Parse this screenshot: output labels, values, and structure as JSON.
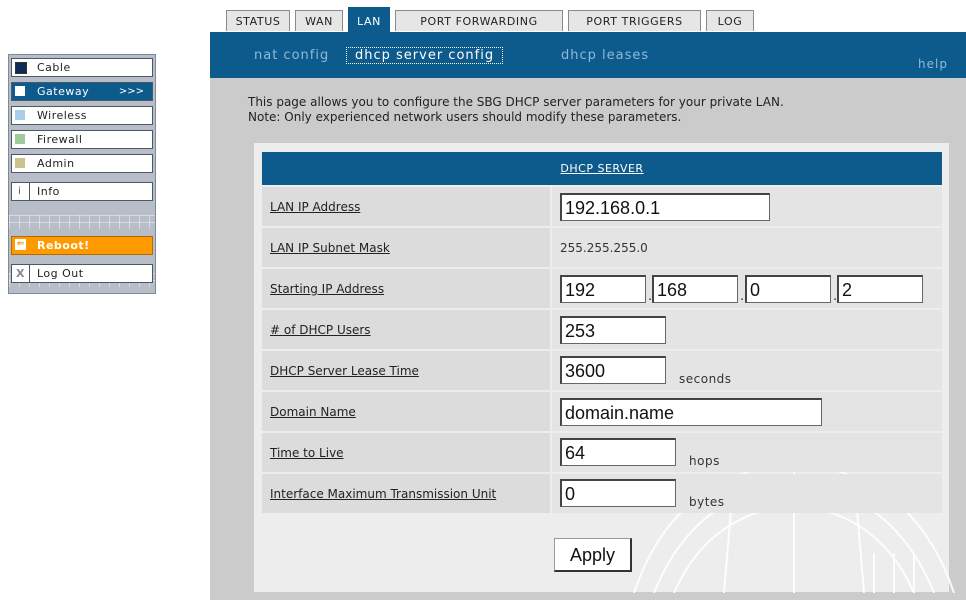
{
  "nav": {
    "items": [
      {
        "label": "Cable",
        "swatch": "#0d2c58"
      },
      {
        "label": "Gateway",
        "swatch": "#ffffff",
        "arrows": ">>>"
      },
      {
        "label": "Wireless",
        "swatch": "#a9cfe8"
      },
      {
        "label": "Firewall",
        "swatch": "#9ccc9c"
      },
      {
        "label": "Admin",
        "swatch": "#c9c48c"
      },
      {
        "label": "Info",
        "icon": "info-icon"
      },
      {
        "label": "Reboot!",
        "icon": "reboot-arrow-icon"
      },
      {
        "label": "Log Out",
        "icon": "close-x-icon"
      }
    ]
  },
  "tabs": [
    "STATUS",
    "WAN",
    "LAN",
    "PORT FORWARDING",
    "PORT TRIGGERS",
    "LOG"
  ],
  "active_tab": "LAN",
  "subtabs": [
    "nat config",
    "dhcp server config",
    "dhcp leases"
  ],
  "active_subtab": "dhcp server config",
  "help": "help",
  "intro": {
    "line1": "This page allows you to configure the SBG DHCP server parameters for your private LAN.",
    "line2": "Note: Only experienced network users should modify these parameters."
  },
  "table": {
    "header": "DHCP SERVER",
    "lan_ip": {
      "label": "LAN IP Address",
      "value": "192.168.0.1"
    },
    "subnet": {
      "label": "LAN IP Subnet Mask",
      "value": "255.255.255.0"
    },
    "start_ip": {
      "label": "Starting IP Address",
      "o1": "192",
      "o2": "168",
      "o3": "0",
      "o4": "2"
    },
    "users": {
      "label": "# of DHCP Users",
      "value": "253"
    },
    "lease": {
      "label": "DHCP Server Lease Time",
      "value": "3600",
      "unit": "seconds"
    },
    "domain": {
      "label": "Domain Name",
      "value": "domain.name"
    },
    "ttl": {
      "label": "Time to Live",
      "value": "64",
      "unit": "hops"
    },
    "mtu": {
      "label": "Interface Maximum Transmission Unit",
      "value": "0",
      "unit": "bytes"
    }
  },
  "apply_label": "Apply",
  "colors": {
    "brand_blue": "#0d5a8c",
    "reboot_orange": "#ff9900",
    "panel_gray": "#cbcbcb"
  }
}
